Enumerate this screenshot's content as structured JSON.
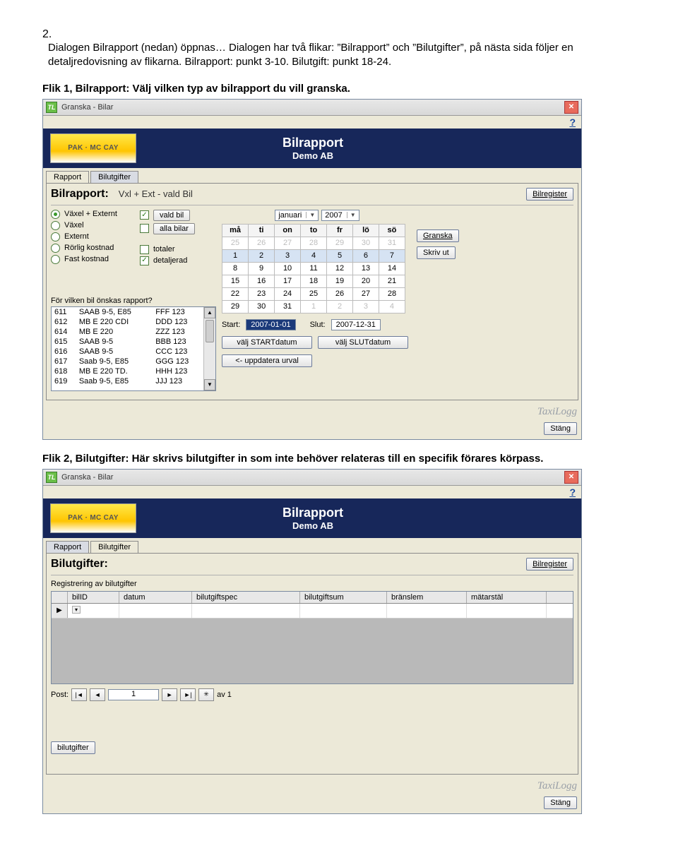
{
  "intro": {
    "num": "2.",
    "text": "Dialogen Bilrapport  (nedan) öppnas… Dialogen har två flikar: ”Bilrapport” och ”Bilutgifter”, på nästa sida följer en detaljredovisning av flikarna. Bilrapport: punkt 3-10. Bilutgift: punkt 18-24."
  },
  "flik1_caption": "Flik 1, Bilrapport: Välj vilken typ av bilrapport du vill granska.",
  "flik2_caption": "Flik 2, Bilutgifter: Här skrivs bilutgifter in som inte behöver relateras till en specifik förares körpass.",
  "win1": {
    "title": "Granska - Bilar",
    "help": "?",
    "logo": "PAK · MC CAY",
    "banner_title": "Bilrapport",
    "banner_sub": "Demo AB",
    "tab_rapport": "Rapport",
    "tab_bilutgifter": "Bilutgifter",
    "heading": "Bilrapport:",
    "heading_sub": "Vxl + Ext - vald Bil",
    "btn_bilregister": "Bilregister",
    "radios": [
      "Växel + Externt",
      "Växel",
      "Externt",
      "Rörlig kostnad",
      "Fast kostnad"
    ],
    "chk_valdbil": "vald bil",
    "chk_allabilar": "alla bilar",
    "chk_totaler": "totaler",
    "chk_detaljerad": "detaljerad",
    "list_label": "För vilken bil önskas rapport?",
    "carlist": [
      [
        "611",
        "SAAB 9-5, E85",
        "FFF 123"
      ],
      [
        "612",
        "MB E 220 CDI",
        "DDD 123"
      ],
      [
        "614",
        "MB E 220",
        "ZZZ 123"
      ],
      [
        "615",
        "SAAB 9-5",
        "BBB 123"
      ],
      [
        "616",
        "SAAB 9-5",
        "CCC 123"
      ],
      [
        "617",
        "Saab 9-5, E85",
        "GGG 123"
      ],
      [
        "618",
        "MB E 220 TD.",
        "HHH 123"
      ],
      [
        "619",
        "Saab 9-5, E85",
        "JJJ 123"
      ]
    ],
    "month": "januari",
    "year": "2007",
    "weekdays": [
      "må",
      "ti",
      "on",
      "to",
      "fr",
      "lö",
      "sö"
    ],
    "cal": [
      {
        "dim": true,
        "d": [
          "25",
          "26",
          "27",
          "28",
          "29",
          "30",
          "31"
        ]
      },
      {
        "sel": true,
        "d": [
          "1",
          "2",
          "3",
          "4",
          "5",
          "6",
          "7"
        ]
      },
      {
        "d": [
          "8",
          "9",
          "10",
          "11",
          "12",
          "13",
          "14"
        ]
      },
      {
        "d": [
          "15",
          "16",
          "17",
          "18",
          "19",
          "20",
          "21"
        ]
      },
      {
        "d": [
          "22",
          "23",
          "24",
          "25",
          "26",
          "27",
          "28"
        ]
      },
      {
        "d": [
          "29",
          "30",
          "31",
          "1",
          "2",
          "3",
          "4"
        ],
        "dim_from": 3
      }
    ],
    "start_lbl": "Start:",
    "start_val": "2007-01-01",
    "slut_lbl": "Slut:",
    "slut_val": "2007-12-31",
    "btn_startdatum": "välj STARTdatum",
    "btn_slutdatum": "välj SLUTdatum",
    "btn_uppdatera": "<- uppdatera urval",
    "btn_granska": "Granska",
    "btn_skrivut": "Skriv ut",
    "btn_stang": "Stäng",
    "taxi": "TaxiLogg"
  },
  "win2": {
    "title": "Granska - Bilar",
    "help": "?",
    "logo": "PAK · MC CAY",
    "banner_title": "Bilrapport",
    "banner_sub": "Demo AB",
    "tab_rapport": "Rapport",
    "tab_bilutgifter": "Bilutgifter",
    "heading": "Bilutgifter:",
    "btn_bilregister": "Bilregister",
    "subheading": "Registrering av bilutgifter",
    "cols": [
      "bilID",
      "datum",
      "bilutgiftspec",
      "bilutgiftsum",
      "bränslem",
      "mätarstäl"
    ],
    "post_lbl": "Post:",
    "post_val": "1",
    "post_of": "av 1",
    "btn_bilutgifter": "bilutgifter",
    "btn_stang": "Stäng",
    "taxi": "TaxiLogg"
  }
}
